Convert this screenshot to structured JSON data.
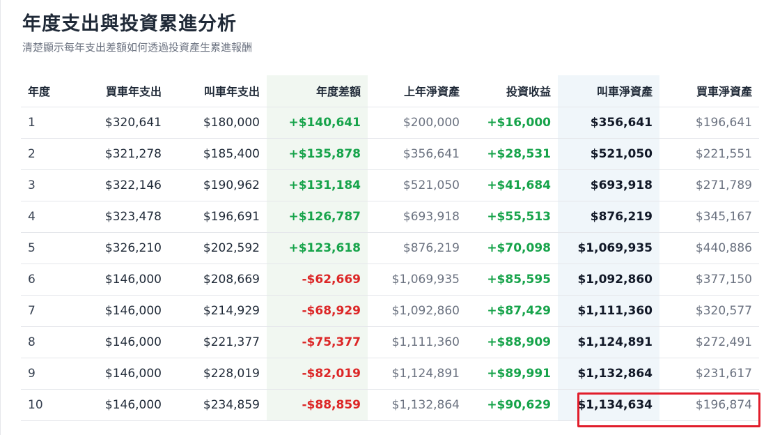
{
  "header": {
    "title": "年度支出與投資累進分析",
    "subtitle": "清楚顯示每年支出差額如何透過投資產生累進報酬"
  },
  "table": {
    "columns": [
      "年度",
      "買車年支出",
      "叫車年支出",
      "年度差額",
      "上年淨資產",
      "投資收益",
      "叫車淨資產",
      "買車淨資產"
    ],
    "rows": [
      [
        "1",
        "$320,641",
        "$180,000",
        "+$140,641",
        "$200,000",
        "+$16,000",
        "$356,641",
        "$196,641"
      ],
      [
        "2",
        "$321,278",
        "$185,400",
        "+$135,878",
        "$356,641",
        "+$28,531",
        "$521,050",
        "$221,551"
      ],
      [
        "3",
        "$322,146",
        "$190,962",
        "+$131,184",
        "$521,050",
        "+$41,684",
        "$693,918",
        "$271,789"
      ],
      [
        "4",
        "$323,478",
        "$196,691",
        "+$126,787",
        "$693,918",
        "+$55,513",
        "$876,219",
        "$345,167"
      ],
      [
        "5",
        "$326,210",
        "$202,592",
        "+$123,618",
        "$876,219",
        "+$70,098",
        "$1,069,935",
        "$440,886"
      ],
      [
        "6",
        "$146,000",
        "$208,669",
        "-$62,669",
        "$1,069,935",
        "+$85,595",
        "$1,092,860",
        "$377,150"
      ],
      [
        "7",
        "$146,000",
        "$214,929",
        "-$68,929",
        "$1,092,860",
        "+$87,429",
        "$1,111,360",
        "$320,577"
      ],
      [
        "8",
        "$146,000",
        "$221,377",
        "-$75,377",
        "$1,111,360",
        "+$88,909",
        "$1,124,891",
        "$272,491"
      ],
      [
        "9",
        "$146,000",
        "$228,019",
        "-$82,019",
        "$1,124,891",
        "+$89,991",
        "$1,132,864",
        "$231,617"
      ],
      [
        "10",
        "$146,000",
        "$234,859",
        "-$88,859",
        "$1,132,864",
        "+$90,629",
        "$1,134,634",
        "$196,874"
      ]
    ]
  },
  "colors": {
    "positive": "#16a34a",
    "negative": "#dc2626",
    "highlight": "#e11d2b"
  }
}
